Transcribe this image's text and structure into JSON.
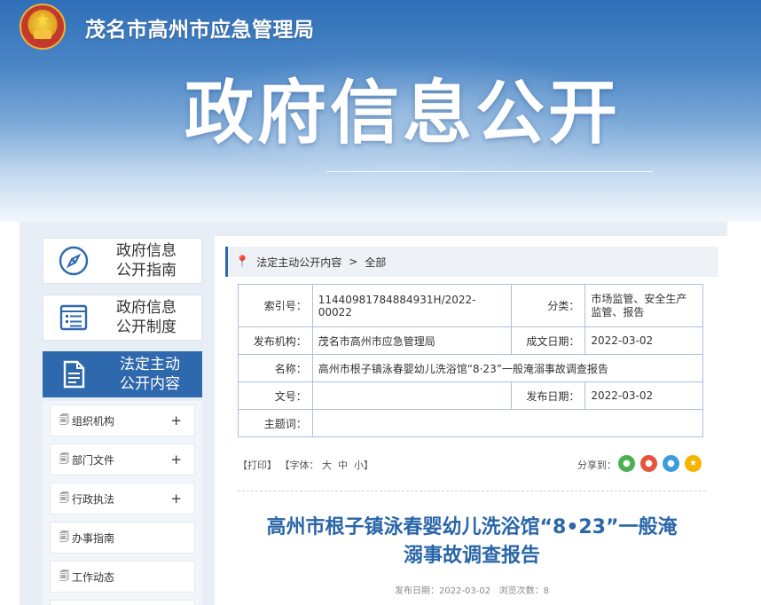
{
  "header": {
    "agency": "茂名市高州市应急管理局",
    "banner_title": "政府信息公开"
  },
  "sidebar": {
    "cards": [
      {
        "label_line1": "政府信息",
        "label_line2": "公开指南",
        "icon": "compass-icon",
        "active": false
      },
      {
        "label_line1": "政府信息",
        "label_line2": "公开制度",
        "icon": "list-icon",
        "active": false
      },
      {
        "label_line1": "法定主动",
        "label_line2": "公开内容",
        "icon": "document-icon",
        "active": true
      }
    ],
    "items": [
      {
        "label": "组织机构",
        "expand": "+"
      },
      {
        "label": "部门文件",
        "expand": "+"
      },
      {
        "label": "行政执法",
        "expand": "+"
      },
      {
        "label": "办事指南",
        "expand": ""
      },
      {
        "label": "工作动态",
        "expand": ""
      }
    ]
  },
  "breadcrumb": {
    "first": "法定主动公开内容",
    "separator": ">",
    "second": "全部"
  },
  "meta": {
    "index_label": "索引号：",
    "index_value": "11440981784884931H/2022-00022",
    "category_label": "分类：",
    "category_value": "市场监管、安全生产监管、报告",
    "publisher_label": "发布机构：",
    "publisher_value": "茂名市高州市应急管理局",
    "created_label": "成文日期：",
    "created_value": "2022-03-02",
    "name_label": "名称：",
    "name_value": "高州市根子镇泳春婴幼儿洗浴馆“8·23”一般淹溺事故调查报告",
    "docno_label": "文号：",
    "docno_value": "",
    "published_label": "发布日期：",
    "published_value": "2022-03-02",
    "keywords_label": "主题词：",
    "keywords_value": ""
  },
  "toolbar": {
    "print": "【打印】",
    "font_label": "【字体：",
    "font_large": "大",
    "font_medium": "中",
    "font_small": "小】",
    "share_label": "分享到："
  },
  "share_icons": [
    {
      "name": "wechat-share-icon",
      "color": "#4caf50"
    },
    {
      "name": "weibo-share-icon",
      "color": "#e8543b"
    },
    {
      "name": "qq-share-icon",
      "color": "#3d9be0"
    },
    {
      "name": "qzone-share-icon",
      "color": "#f4b400"
    }
  ],
  "article": {
    "title_line1": "高州市根子镇泳春婴幼儿洗浴馆“8•23”一般淹",
    "title_line2": "溺事故调查报告",
    "date_label": "发布日期：",
    "date_value": "2022-03-02",
    "views_label": "浏览次数：",
    "views_value": "8"
  }
}
